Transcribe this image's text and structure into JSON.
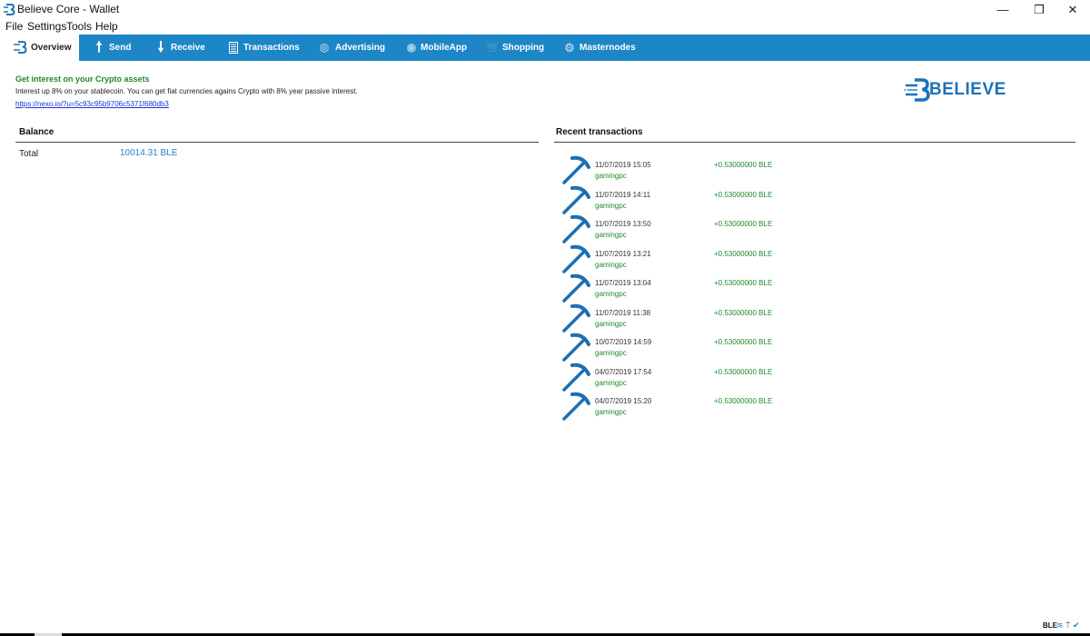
{
  "window": {
    "title": "Believe Core - Wallet",
    "minimize_glyph": "—",
    "maximize_glyph": "❐",
    "close_glyph": "✕"
  },
  "menu": [
    "File",
    "Settings",
    "Tools",
    "Help"
  ],
  "tabs": [
    {
      "label": "Overview",
      "icon": "believe-logo-icon",
      "active": true
    },
    {
      "label": "Send",
      "icon": "arrow-up-icon"
    },
    {
      "label": "Receive",
      "icon": "arrow-down-icon"
    },
    {
      "label": "Transactions",
      "icon": "document-list-icon"
    },
    {
      "label": "Advertising",
      "icon": "advertising-icon"
    },
    {
      "label": "MobileApp",
      "icon": "mobile-app-icon"
    },
    {
      "label": "Shopping",
      "icon": "shopping-cart-icon"
    },
    {
      "label": "Masternodes",
      "icon": "masternodes-icon"
    }
  ],
  "promo": {
    "title": "Get interest on your Crypto assets",
    "text": "Interest up 8% on your stablecoin. You can get fiat currencies agains Crypto with 8% year passive interest.",
    "link": "https://nexo.io/?u=5c93c95b9706c5371f680db3"
  },
  "brand": {
    "logo_text": "BELIEVE",
    "color": "#1d72b8"
  },
  "balance": {
    "section_title": "Balance",
    "total_label": "Total",
    "total_value": "10014.31 BLE"
  },
  "recent": {
    "section_title": "Recent transactions",
    "items": [
      {
        "date": "11/07/2019 15:05",
        "address": "gamingpc",
        "amount": "+0.53000000 BLE"
      },
      {
        "date": "11/07/2019 14:11",
        "address": "gamingpc",
        "amount": "+0.53000000 BLE"
      },
      {
        "date": "11/07/2019 13:50",
        "address": "gamingpc",
        "amount": "+0.53000000 BLE"
      },
      {
        "date": "11/07/2019 13:21",
        "address": "gamingpc",
        "amount": "+0.53000000 BLE"
      },
      {
        "date": "11/07/2019 13:04",
        "address": "gamingpc",
        "amount": "+0.53000000 BLE"
      },
      {
        "date": "11/07/2019 11:38",
        "address": "gamingpc",
        "amount": "+0.53000000 BLE"
      },
      {
        "date": "10/07/2019 14:59",
        "address": "gamingpc",
        "amount": "+0.53000000 BLE"
      },
      {
        "date": "04/07/2019 17:54",
        "address": "gamingpc",
        "amount": "+0.53000000 BLE"
      },
      {
        "date": "04/07/2019 15:20",
        "address": "gamingpc",
        "amount": "+0.53000000 BLE"
      }
    ]
  },
  "status": {
    "unit": "BLE"
  },
  "colors": {
    "toolbar": "#1c86c6",
    "positive": "#1e8a2a",
    "link": "#1d35d6"
  }
}
